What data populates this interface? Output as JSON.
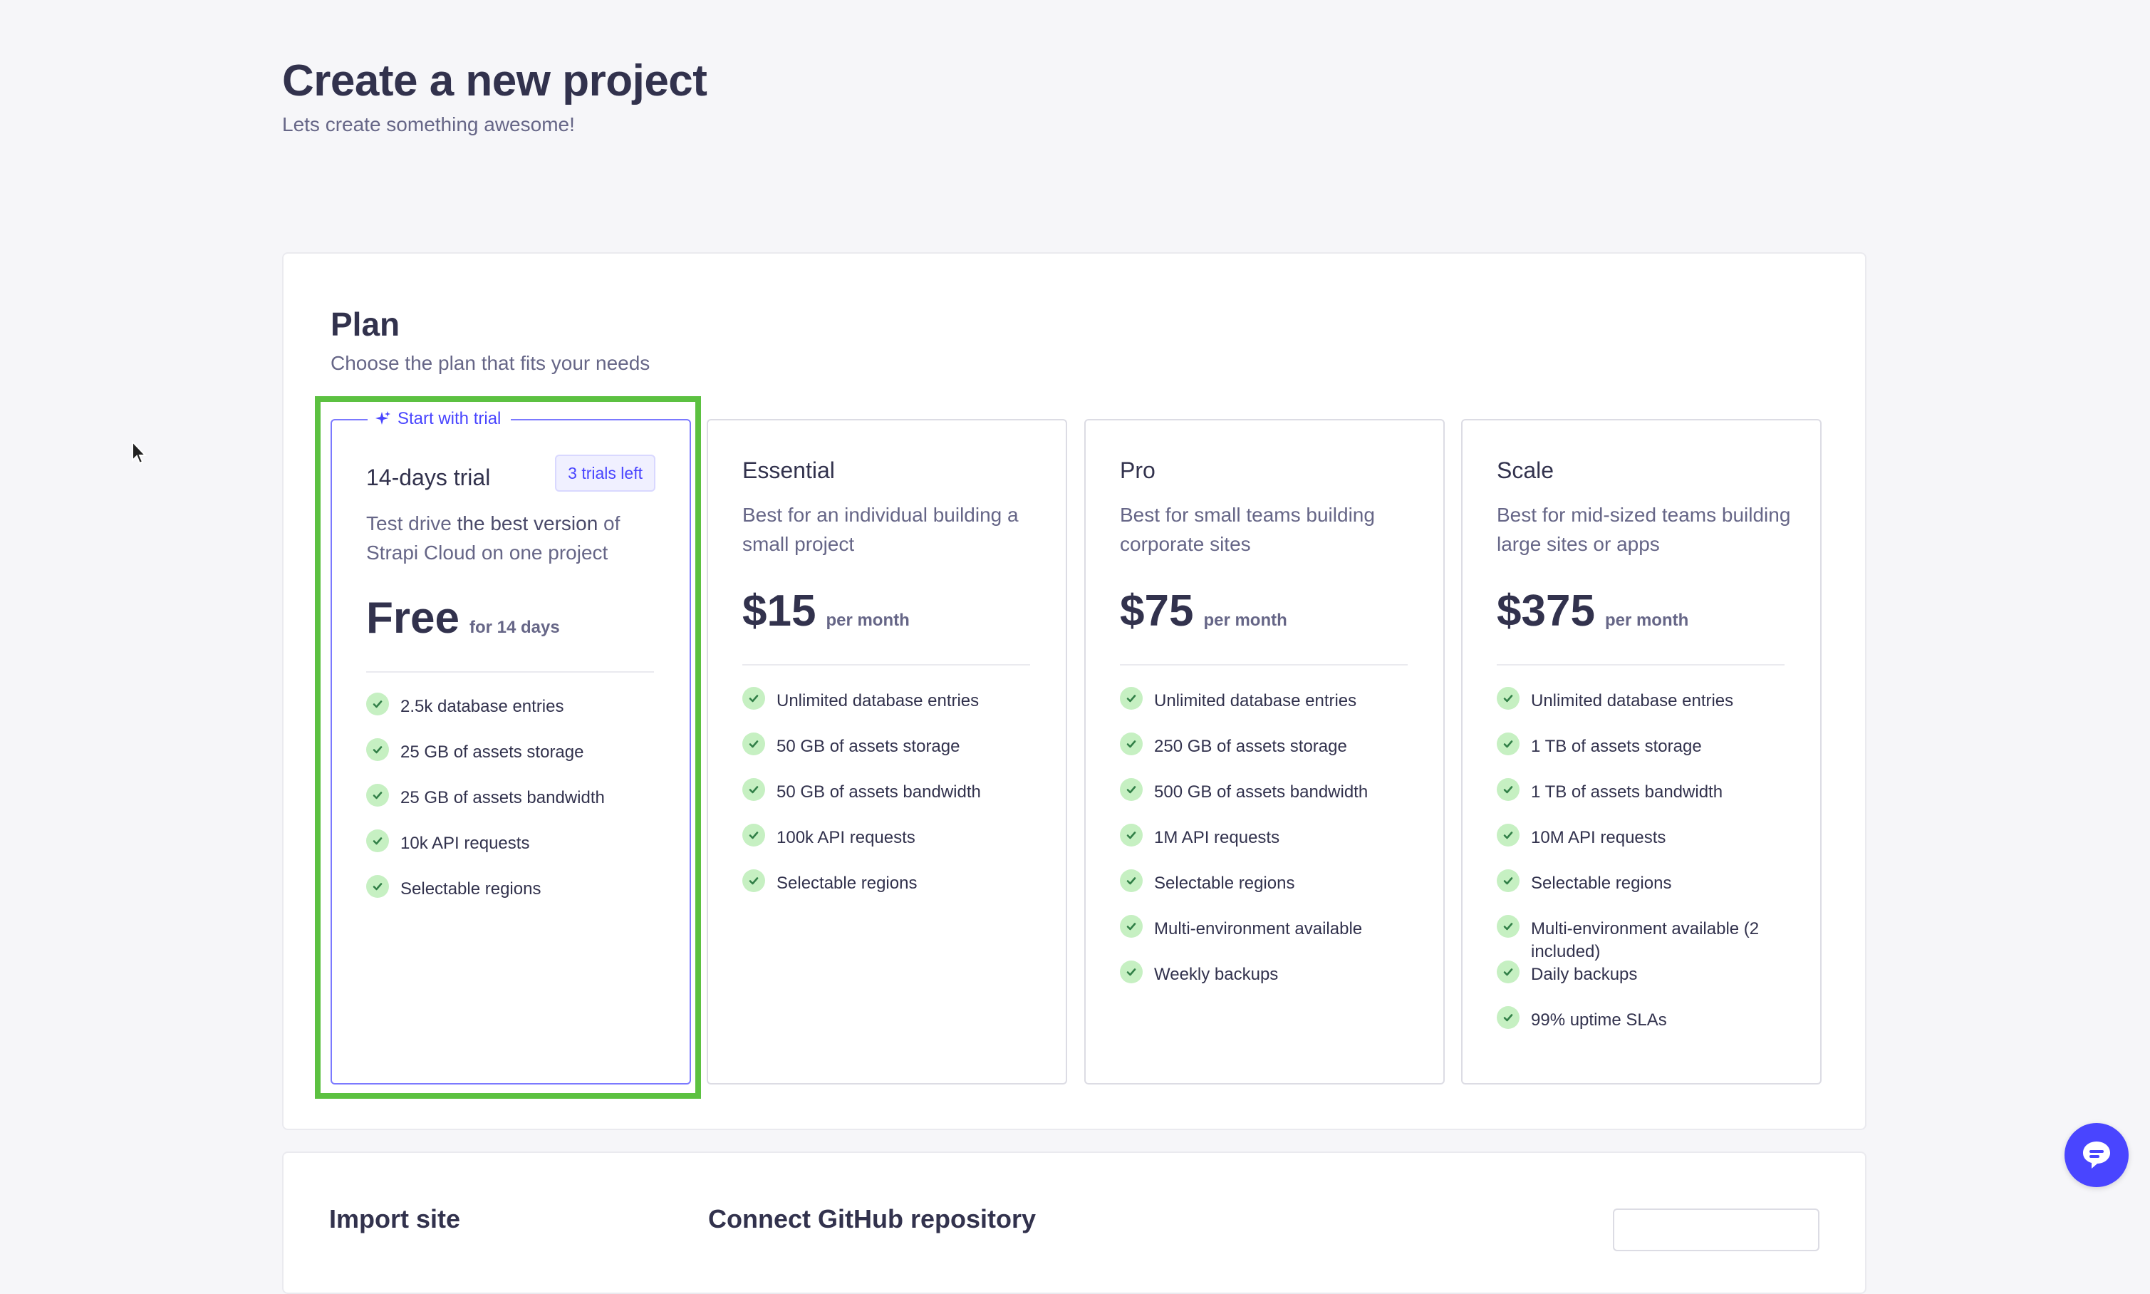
{
  "header": {
    "title": "Create a new project",
    "subtitle": "Lets create something awesome!"
  },
  "plan": {
    "title": "Plan",
    "subtitle": "Choose the plan that fits your needs",
    "trial_card": {
      "legend": "Start with trial",
      "name": "14-days trial",
      "badge": "3 trials left",
      "desc_pre": "Test drive ",
      "desc_em": "the best version",
      "desc_post": " of Strapi Cloud on one project",
      "price": "Free",
      "price_note": "for 14 days",
      "features": [
        "2.5k database entries",
        "25 GB of assets storage",
        "25 GB of assets bandwidth",
        "10k API requests",
        "Selectable regions"
      ]
    },
    "cards": [
      {
        "name": "Essential",
        "desc": "Best for an individual building a small project",
        "price": "$15",
        "price_note": "per month",
        "features": [
          "Unlimited database entries",
          "50 GB of assets storage",
          "50 GB of assets bandwidth",
          "100k API requests",
          "Selectable regions"
        ]
      },
      {
        "name": "Pro",
        "desc": "Best for small teams building corporate sites",
        "price": "$75",
        "price_note": "per month",
        "features": [
          "Unlimited database entries",
          "250 GB of assets storage",
          "500 GB of assets bandwidth",
          "1M API requests",
          "Selectable regions",
          "Multi-environment available",
          "Weekly backups"
        ]
      },
      {
        "name": "Scale",
        "desc": "Best for mid-sized teams building large sites or apps",
        "price": "$375",
        "price_note": "per month",
        "features": [
          "Unlimited database entries",
          "1 TB of assets storage",
          "1 TB of assets bandwidth",
          "10M API requests",
          "Selectable regions",
          "Multi-environment available (2 included)",
          "Daily backups",
          "99% uptime SLAs"
        ]
      }
    ]
  },
  "bottom": {
    "left_title": "Import site",
    "mid_title": "Connect GitHub repository"
  },
  "icons": {
    "check": "check-icon",
    "sparkle": "sparkle-icon",
    "chat": "chat-icon",
    "cursor": "mouse-cursor-icon"
  },
  "colors": {
    "accent": "#4945ff",
    "success": "#5cc141",
    "text": "#32324d",
    "muted": "#666687"
  }
}
